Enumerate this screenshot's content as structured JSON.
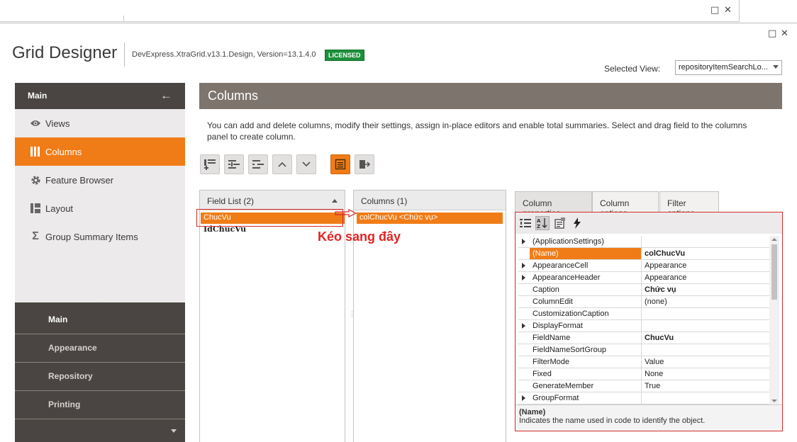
{
  "window": {
    "bg_restore": "□",
    "bg_close": "✕",
    "restore": "□",
    "close": "✕"
  },
  "header": {
    "title": "Grid Designer",
    "assembly": "DevExpress.XtraGrid.v13.1.Design, Version=13.1.4.0",
    "license": "LICENSED",
    "selected_view_label": "Selected View:",
    "selected_view_value": "repositoryItemSearchLo..."
  },
  "nav": {
    "header": "Main",
    "back_icon": "arrow-left-icon",
    "items": [
      {
        "label": "Views",
        "icon": "eye-icon",
        "active": false
      },
      {
        "label": "Columns",
        "icon": "columns-icon",
        "active": true
      },
      {
        "label": "Feature Browser",
        "icon": "gear-icon",
        "active": false
      },
      {
        "label": "Layout",
        "icon": "layout-icon",
        "active": false
      },
      {
        "label": "Group Summary Items",
        "icon": "sigma-icon",
        "active": false
      }
    ],
    "groups": [
      "Main",
      "Appearance",
      "Repository",
      "Printing"
    ]
  },
  "content": {
    "title": "Columns",
    "description": "You can add and delete columns, modify their settings, assign in-place editors and enable total summaries. Select and drag field to the columns panel to create column."
  },
  "toolbar": {
    "buttons": [
      {
        "name": "add-column-button",
        "icon": "add-column-icon"
      },
      {
        "name": "insert-column-button",
        "icon": "insert-column-icon"
      },
      {
        "name": "remove-column-button",
        "icon": "remove-column-icon"
      },
      {
        "name": "move-up-button",
        "icon": "chevron-up-icon"
      },
      {
        "name": "move-down-button",
        "icon": "chevron-down-icon"
      },
      {
        "name": "show-field-list-button",
        "icon": "field-list-icon",
        "active": true
      },
      {
        "name": "retrieve-fields-button",
        "icon": "retrieve-icon"
      }
    ]
  },
  "field_list": {
    "header": "Field List (2)",
    "items": [
      "ChucVu",
      "IdChucVu"
    ]
  },
  "columns_panel": {
    "header": "Columns (1)",
    "items": [
      "colChucVu <Chức vụ>"
    ]
  },
  "annotation": "Kéo sang đây",
  "tabs": [
    "Column properties",
    "Column options",
    "Filter options"
  ],
  "property_grid": {
    "rows": [
      {
        "name": "(ApplicationSettings)",
        "value": "",
        "expandable": true,
        "bold": false,
        "selected": false
      },
      {
        "name": "(Name)",
        "value": "colChucVu",
        "expandable": false,
        "bold": true,
        "selected": true
      },
      {
        "name": "AppearanceCell",
        "value": "Appearance",
        "expandable": true,
        "bold": false,
        "selected": false
      },
      {
        "name": "AppearanceHeader",
        "value": "Appearance",
        "expandable": true,
        "bold": false,
        "selected": false
      },
      {
        "name": "Caption",
        "value": "Chức vụ",
        "expandable": false,
        "bold": true,
        "selected": false
      },
      {
        "name": "ColumnEdit",
        "value": "(none)",
        "expandable": false,
        "bold": false,
        "selected": false
      },
      {
        "name": "CustomizationCaption",
        "value": "",
        "expandable": false,
        "bold": false,
        "selected": false
      },
      {
        "name": "DisplayFormat",
        "value": "",
        "expandable": true,
        "bold": false,
        "selected": false
      },
      {
        "name": "FieldName",
        "value": "ChucVu",
        "expandable": false,
        "bold": true,
        "selected": false
      },
      {
        "name": "FieldNameSortGroup",
        "value": "",
        "expandable": false,
        "bold": false,
        "selected": false
      },
      {
        "name": "FilterMode",
        "value": "Value",
        "expandable": false,
        "bold": false,
        "selected": false
      },
      {
        "name": "Fixed",
        "value": "None",
        "expandable": false,
        "bold": false,
        "selected": false
      },
      {
        "name": "GenerateMember",
        "value": "True",
        "expandable": false,
        "bold": false,
        "selected": false
      },
      {
        "name": "GroupFormat",
        "value": "",
        "expandable": true,
        "bold": false,
        "selected": false
      }
    ],
    "description_title": "(Name)",
    "description_text": "Indicates the name used in code to identify the object."
  },
  "colors": {
    "accent": "#f07c17",
    "nav_dark": "#4a4542",
    "header_bar": "#7d746e",
    "annotation_red": "#e02424",
    "license_green": "#1d8f3a"
  }
}
